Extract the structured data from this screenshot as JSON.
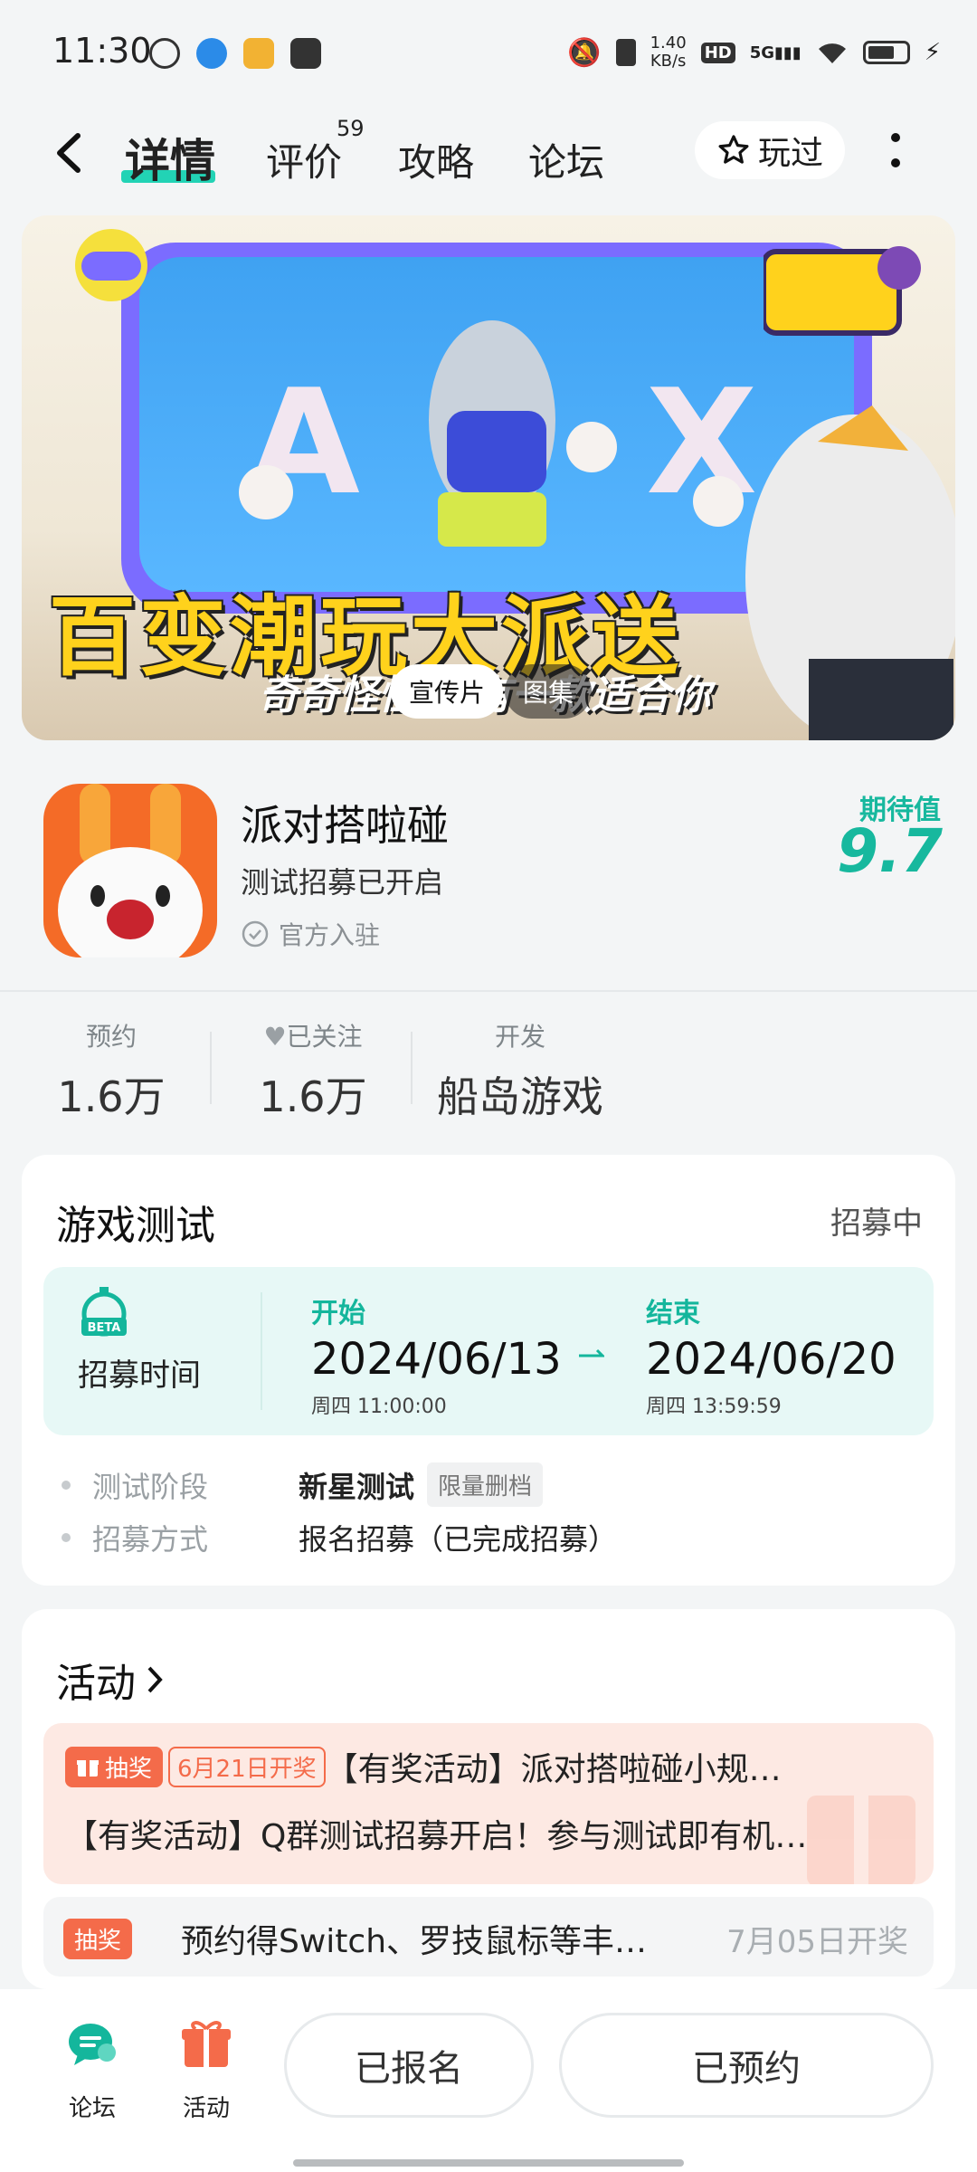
{
  "status_bar": {
    "time": "11:30",
    "net_speed_value": "1.40",
    "net_speed_unit": "KB/s",
    "hd_label": "HD",
    "signal_label": "5G"
  },
  "nav": {
    "tabs": [
      {
        "label": "详情"
      },
      {
        "label": "评价"
      },
      {
        "label": "攻略"
      },
      {
        "label": "论坛"
      }
    ],
    "reviews_count": "59",
    "played_label": "玩过"
  },
  "banner": {
    "title": "百变潮玩大派送",
    "subtitle": "奇奇怪怪 总有一款适合你",
    "video_chip": "宣传片",
    "gallery_chip": "图集"
  },
  "game": {
    "name": "派对搭啦碰",
    "status": "测试招募已开启",
    "official": "官方入驻",
    "expect_label": "期待值",
    "expect_value": "9.7"
  },
  "stats": {
    "reserve_label": "预约",
    "reserve_value": "1.6万",
    "follow_label": "已关注",
    "follow_value": "1.6万",
    "dev_label": "开发",
    "dev_value": "船岛游戏"
  },
  "test_card": {
    "title": "游戏测试",
    "status": "招募中",
    "recruit_label": "招募时间",
    "start_label": "开始",
    "start_date": "2024/06/13",
    "start_sub": "周四  11:00:00",
    "end_label": "结束",
    "end_date": "2024/06/20",
    "end_sub": "周四  13:59:59",
    "phase_key": "测试阶段",
    "phase_value": "新星测试",
    "phase_tag": "限量删档",
    "method_key": "招募方式",
    "method_value": "报名招募（已完成招募）"
  },
  "activity": {
    "title": "活动",
    "lottery_badge": "抽奖",
    "date_badge": "6月21日开奖",
    "line1": "【有奖活动】派对搭啦碰小规…",
    "line2": "【有奖活动】Q群测试招募开启！参与测试即有机…",
    "row2_text": "预约得Switch、罗技鼠标等丰…",
    "row2_date": "7月05日开奖"
  },
  "bottom_bar": {
    "forum_label": "论坛",
    "activity_label": "活动",
    "signed_up": "已报名",
    "reserved": "已预约"
  },
  "colors": {
    "accent": "#17b89e",
    "tab_underline": "#22d3b5",
    "lottery": "#f46b4a",
    "app_icon_bg": "#f46b27"
  }
}
